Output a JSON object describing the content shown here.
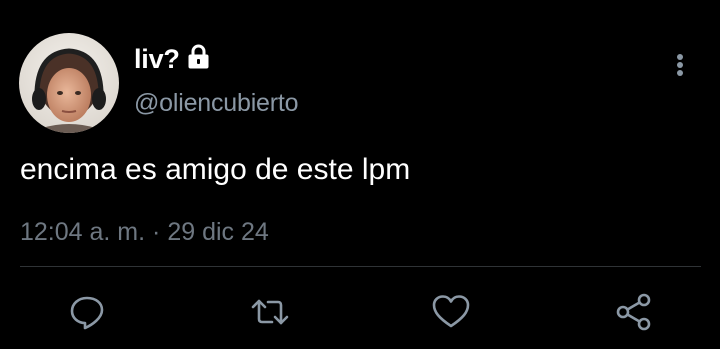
{
  "tweet": {
    "display_name": "liv?",
    "handle": "@oliencubierto",
    "text": "encima es amigo de este lpm",
    "time": "12:04 a. m.",
    "separator": "·",
    "date": "29 dic 24",
    "meta_line": "12:04 a. m. · 29 dic 24",
    "protected": true
  },
  "icons": {
    "lock": "lock-icon",
    "more": "more-vertical-icon",
    "reply": "reply-icon",
    "retweet": "retweet-icon",
    "like": "heart-icon",
    "share": "share-icon"
  },
  "colors": {
    "background": "#000000",
    "text": "#ffffff",
    "secondary": "#8b98a5",
    "meta": "#6e7781",
    "divider": "#2f3336",
    "action_icon": "#8b98a5"
  }
}
